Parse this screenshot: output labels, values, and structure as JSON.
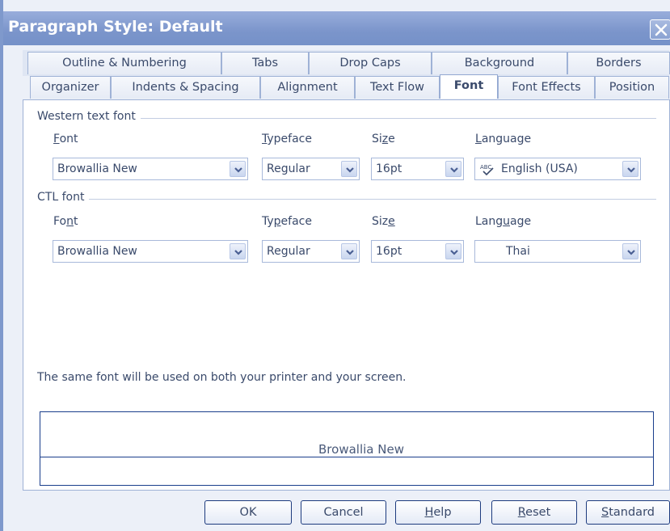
{
  "window": {
    "title": "Paragraph Style: Default"
  },
  "tabs": {
    "row_top": [
      "Outline & Numbering",
      "Tabs",
      "Drop Caps",
      "Background",
      "Borders"
    ],
    "row_bottom": [
      "Organizer",
      "Indents & Spacing",
      "Alignment",
      "Text Flow",
      "Font",
      "Font Effects",
      "Position"
    ],
    "active": "Font"
  },
  "western": {
    "group_label": "Western text font",
    "font_label": "Font",
    "typeface_label": "Typeface",
    "size_label": "Size",
    "language_label": "Language",
    "font_value": "Browallia New",
    "typeface_value": "Regular",
    "size_value": "16pt",
    "language_value": "English (USA)",
    "language_icon": "spellcheck-abc-icon"
  },
  "ctl": {
    "group_label": "CTL font",
    "font_label": "Font",
    "typeface_label": "Typeface",
    "size_label": "Size",
    "language_label": "Language",
    "font_value": "Browallia New",
    "typeface_value": "Regular",
    "size_value": "16pt",
    "language_value": "Thai"
  },
  "note": "The same font will be used on both your printer and your screen.",
  "preview": {
    "text": "Browallia New"
  },
  "buttons": {
    "ok": "OK",
    "cancel": "Cancel",
    "help": "Help",
    "reset": "Reset",
    "standard": "Standard"
  },
  "colors": {
    "title_bar": "#7b95cb",
    "border_accent": "#1a3e8c",
    "text": "#3a4a6b"
  }
}
